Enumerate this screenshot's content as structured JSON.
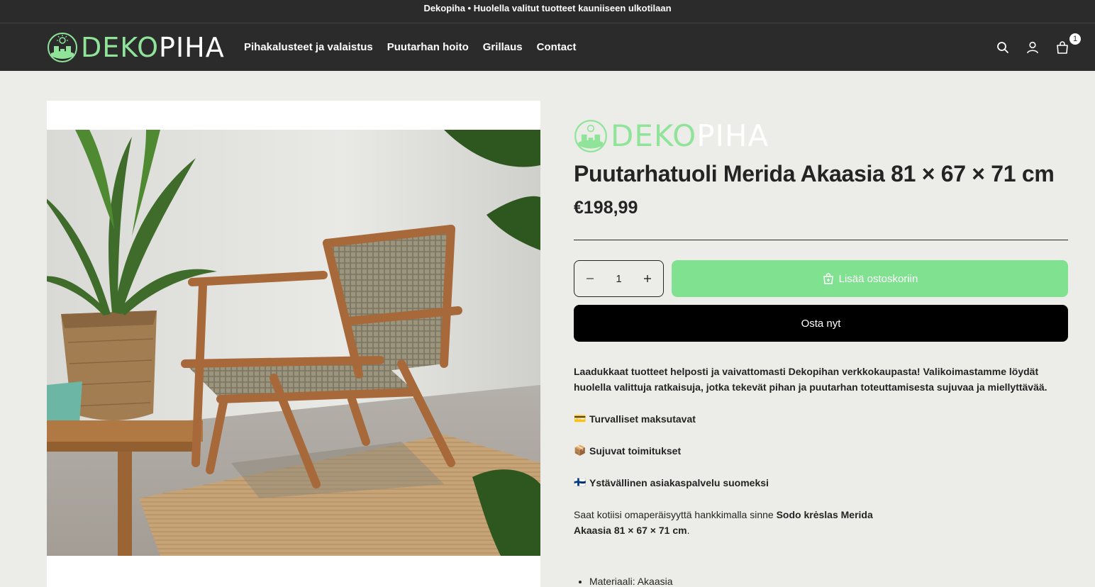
{
  "announcement": "Dekopiha • Huolella valitut tuotteet kauniiseen ulkotilaan",
  "brand": {
    "part1": "DEKO",
    "part2": "PIHA",
    "accent_color": "#8fe49a"
  },
  "nav": {
    "items": [
      {
        "label": "Pihakalusteet ja valaistus"
      },
      {
        "label": "Puutarhan hoito"
      },
      {
        "label": "Grillaus"
      },
      {
        "label": "Contact"
      }
    ]
  },
  "header_icons": {
    "search": "search-icon",
    "account": "account-icon",
    "cart": "cart-icon",
    "cart_count": "1"
  },
  "product": {
    "title": "Puutarhatuoli Merida Akaasia 81 × 67 × 71 cm",
    "price": "€198,99",
    "quantity": "1",
    "add_to_cart_label": "Lisää ostoskoriin",
    "buy_now_label": "Osta nyt",
    "description": {
      "intro": "Laadukkaat tuotteet helposti ja vaivattomasti Dekopihan verkkokaupasta! Valikoimastamme löydät huolella valittuja ratkaisuja, jotka tekevät pihan ja puutarhan toteuttamisesta sujuvaa ja miellyttävää.",
      "features": [
        {
          "icon": "💳",
          "text": "Turvalliset maksutavat"
        },
        {
          "icon": "📦",
          "text": "Sujuvat toimitukset"
        },
        {
          "icon": "🇫🇮",
          "text": "Ystävällinen asiakaspalvelu suomeksi"
        }
      ],
      "body_prefix": "Saat kotiisi omaperäisyyttä hankkimalla sinne ",
      "body_bold": "Sodo krėslas Merida Akaasia 81 × 67 × 71 cm",
      "body_suffix": ".",
      "list": [
        "Materiaali: Akaasia"
      ]
    }
  }
}
